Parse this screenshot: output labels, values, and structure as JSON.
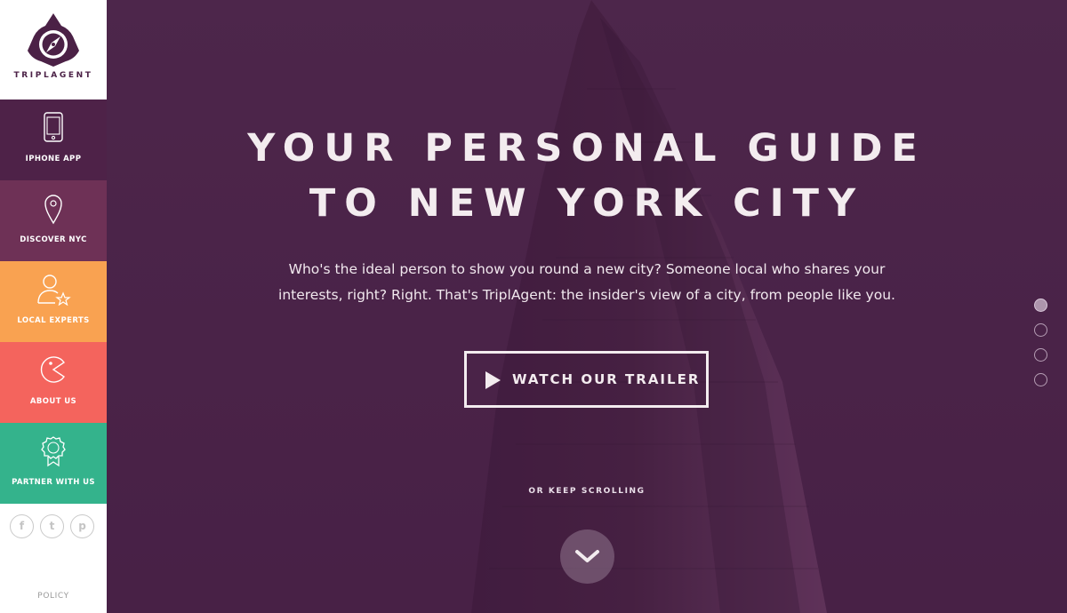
{
  "brand": {
    "name": "TRIPLAGENT",
    "color": "#4b2146"
  },
  "nav": [
    {
      "label": "IPHONE APP",
      "icon": "phone-icon",
      "color": "#4e2248"
    },
    {
      "label": "DISCOVER NYC",
      "icon": "map-pin-icon",
      "color": "#6e3156"
    },
    {
      "label": "LOCAL EXPERTS",
      "icon": "user-star-icon",
      "color": "#f9a251"
    },
    {
      "label": "ABOUT US",
      "icon": "pacman-icon",
      "color": "#f4645d"
    },
    {
      "label": "PARTNER WITH US",
      "icon": "badge-ribbon-icon",
      "color": "#34b38c"
    }
  ],
  "social": [
    {
      "glyph": "f",
      "icon": "facebook-icon"
    },
    {
      "glyph": "t",
      "icon": "twitter-icon"
    },
    {
      "glyph": "p",
      "icon": "pinterest-icon"
    }
  ],
  "footer": {
    "policy": "POLICY"
  },
  "hero": {
    "headline_line1": "YOUR PERSONAL GUIDE",
    "headline_line2": "TO NEW YORK CITY",
    "desc_line1": "Who's the ideal person to show you round a new city? Someone local who shares your",
    "desc_line2": "interests, right? Right. That's TriplAgent: the insider's view of a city, from people like you.",
    "trailer_label": "WATCH OUR TRAILER",
    "scroll_label": "OR KEEP SCROLLING"
  },
  "pagination": {
    "count": 4,
    "active": 1
  }
}
